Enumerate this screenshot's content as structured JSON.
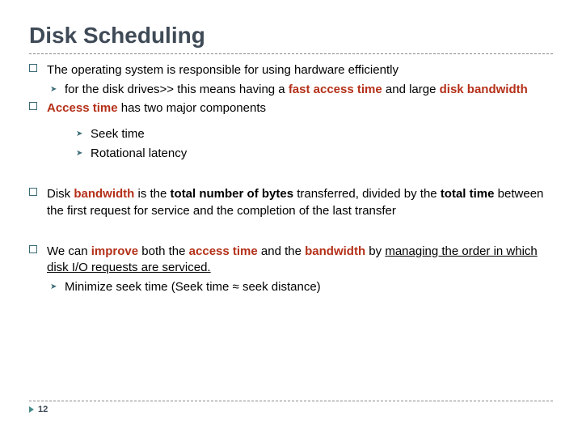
{
  "title": "Disk Scheduling",
  "b1": {
    "line1_pre": "The operating system is responsible for using hardware efficiently",
    "sub_pre": "for the disk drives>> this means having a ",
    "sub_fast": "fast access time",
    "sub_and": " and large ",
    "sub_band": "disk bandwidth"
  },
  "b2": {
    "acc": "Access time",
    "rest": " has two major components",
    "seek": "Seek time",
    "rot": "Rotational latency"
  },
  "b3": {
    "p1": "Disk ",
    "p2": "bandwidth",
    "p3": " is the ",
    "p4": "total number of bytes",
    "p5": " transferred, divided by the ",
    "p6": "total time",
    "p7": " between the first request for service and the completion of the last transfer"
  },
  "b4": {
    "p1": "We can ",
    "p2": "improve",
    "p3": " both the ",
    "p4": "access time",
    "p5": " and the ",
    "p6": "bandwidth",
    "p7": " by ",
    "p8": "managing the order in which disk I/O requests are serviced.",
    "sub": "Minimize seek time  (Seek time ≈ seek distance)"
  },
  "pagenum": "12"
}
